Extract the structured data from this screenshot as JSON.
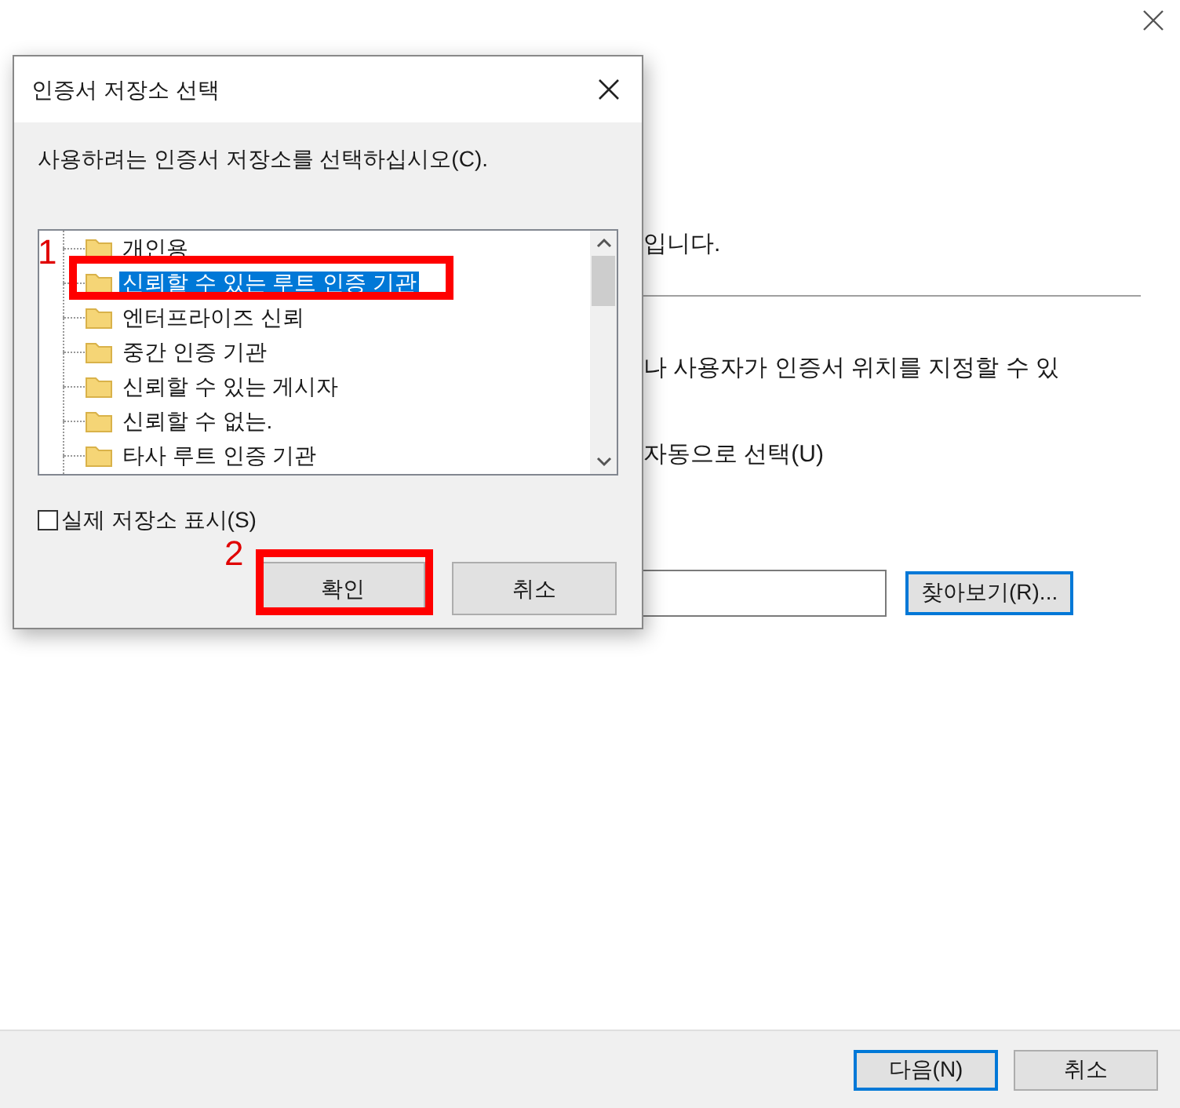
{
  "wizard": {
    "texts": [
      "입니다.",
      "나 사용자가 인증서 위치를 지정할 수 있",
      "자동으로 선택(U)"
    ],
    "browse_button": "찾아보기(R)...",
    "buttons": [
      {
        "label": "다음(N)",
        "default": true
      },
      {
        "label": "취소",
        "default": false
      }
    ]
  },
  "dialog": {
    "title": "인증서 저장소 선택",
    "instruction": "사용하려는 인증서 저장소를 선택하십시오(C).",
    "tree": [
      {
        "label": "개인용",
        "selected": false
      },
      {
        "label": "신뢰할 수 있는 루트 인증 기관",
        "selected": true
      },
      {
        "label": "엔터프라이즈 신뢰",
        "selected": false
      },
      {
        "label": "중간 인증 기관",
        "selected": false
      },
      {
        "label": "신뢰할 수 있는 게시자",
        "selected": false
      },
      {
        "label": "신뢰할 수 없는.",
        "selected": false
      },
      {
        "label": "타사 루트 인증 기관",
        "selected": false
      }
    ],
    "show_physical": {
      "label": "실제 저장소 표시(S)",
      "checked": false
    },
    "buttons": [
      {
        "label": "확인"
      },
      {
        "label": "취소"
      }
    ]
  },
  "annotations": [
    {
      "label": "1"
    },
    {
      "label": "2"
    }
  ]
}
